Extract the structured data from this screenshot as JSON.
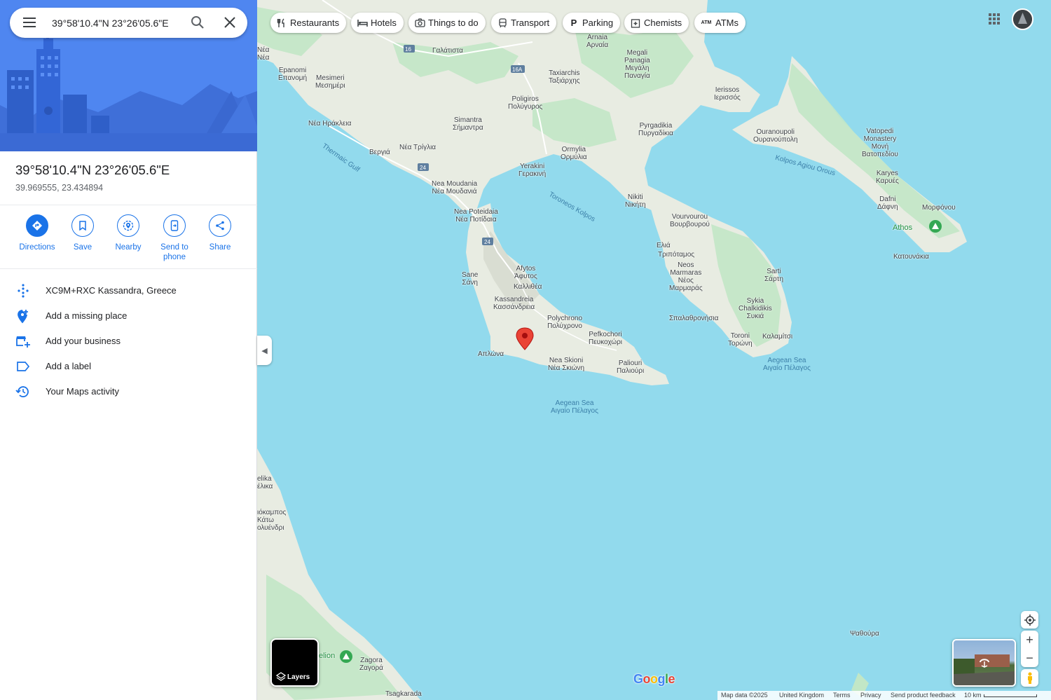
{
  "search": {
    "value": "39°58'10.4\"N 23°26'05.6\"E"
  },
  "place": {
    "title": "39°58'10.4\"N 23°26'05.6\"E",
    "coords": "39.969555, 23.434894"
  },
  "actions": [
    {
      "label": "Directions"
    },
    {
      "label": "Save"
    },
    {
      "label": "Nearby"
    },
    {
      "label": "Send to phone"
    },
    {
      "label": "Share"
    }
  ],
  "info_rows": [
    {
      "text": "XC9M+RXC Kassandra, Greece",
      "icon": "plus-code-icon"
    },
    {
      "text": "Add a missing place",
      "icon": "add-place-icon"
    },
    {
      "text": "Add your business",
      "icon": "add-business-icon"
    },
    {
      "text": "Add a label",
      "icon": "label-icon"
    },
    {
      "text": "Your Maps activity",
      "icon": "history-icon"
    }
  ],
  "chips": [
    "Restaurants",
    "Hotels",
    "Things to do",
    "Transport",
    "Parking",
    "Chemists",
    "ATMs"
  ],
  "layers_label": "Layers",
  "map_labels": {
    "galatista": "Γαλάτιστα",
    "arnaia": "Arnaia\nΑρναία",
    "megali_panagia": "Megali\nPanagia\nΜεγάλη\nΠαναγία",
    "taxiarchis": "Taxiarchis\nΤαξιάρχης",
    "poligiros": "Poligiros\nΠολύγυρος",
    "ierissos": "Ierissos\nΙερισσός",
    "ouranoupoli": "Ouranoupoli\nΟυρανούπολη",
    "vatopedi": "Vatopedi\nMonastery\nΜονή\nΒατοπεδίου",
    "karyes": "Karyes\nΚαρυές",
    "dafni": "Dafni\nΔάφνη",
    "morfonou": "Μορφόνου",
    "athos": "Athos",
    "katounakia": "Κατουνάκια",
    "epanomi": "Epanomi\nΕπανομή",
    "mesimeri": "Mesimeri\nΜεσημέρι",
    "nea_irakleia": "Νέα Ηράκλεια",
    "simantra": "Simantra\nΣήμαντρα",
    "pyrgadikia": "Pyrgadikia\nΠυργαδίκια",
    "veria": "Βεργιά",
    "nea_trilia": "Νέα Τρίγλια",
    "ormylia": "Ormylia\nΟρμύλια",
    "yerakini": "Yerakini\nΓερακινή",
    "nea_moudania": "Nea Moudania\nΝέα Μουδανιά",
    "nikiti": "Nikiti\nΝικήτη",
    "vourvourou": "Vourvourou\nΒουρβουρού",
    "nea_poteidaia": "Nea Poteidaia\nΝέα Ποτίδαια",
    "elia": "Ελιά",
    "tripotamos": "Τριπόταμος",
    "neos_marmaras": "Neos\nMarmaras\nΝέος\nΜαρμαράς",
    "sarti": "Sarti\nΣάρτη",
    "afytos": "Afytos\nΆφυτος",
    "kallithea": "Καλλιθέα",
    "sane": "Sane\nΣάνη",
    "kassandreia": "Kassandreia\nΚασσάνδρεια",
    "spalathronisia": "Σπαλαθρονήσια",
    "sykia": "Sykia\nChalkidikis\nΣυκιά",
    "polychrono": "Polychrono\nΠολύχρονο",
    "pefkochori": "Pefkochori\nΠευκοχώρι",
    "toroni": "Toroni\nΤορώνη",
    "kalamitsi": "Καλαμίτσι",
    "aplona": "Απλώνα",
    "nea_skioni": "Nea Skioni\nΝέα Σκιώνη",
    "paliouri": "Paliouri\nΠαλιούρι",
    "thermaic_gulf": "Thermaic Gulf",
    "toroneos_kolpos": "Toroneos Kolpos",
    "kolpos_agiou_orous": "Kolpos Agiou Orous",
    "aegean_sea_1": "Aegean Sea\nΑιγαίο Πέλαγος",
    "aegean_sea_2": "Aegean Sea\nΑιγαίο Πέλαγος",
    "nea_w": "Νέα\nΝέα",
    "elika": "elika\nέλικα",
    "okampos": "ιόκαμπος\nΚάτω\nολυένδρι",
    "pelion": "elion",
    "zagora": "Zagora\nΖαγορά",
    "tsagkarada": "Tsagkarada",
    "psathoura": "Ψαθούρα",
    "road_16": "16",
    "road_16a": "16A",
    "road_24a": "24",
    "road_24b": "24"
  },
  "footer": {
    "map_data": "Map data ©2025",
    "country": "United Kingdom",
    "terms": "Terms",
    "privacy": "Privacy",
    "feedback": "Send product feedback",
    "scale": "10 km"
  },
  "google_logo": "Google",
  "colors": {
    "accent": "#1a73e8",
    "water": "#92daed",
    "land": "#e8ece2",
    "forest": "#c2e7c6",
    "pin": "#ea4335"
  }
}
